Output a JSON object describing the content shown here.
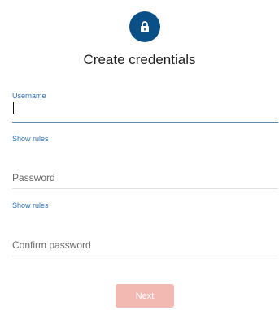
{
  "header": {
    "icon": "lock-icon",
    "title": "Create credentials"
  },
  "username": {
    "label": "Username",
    "value": "",
    "rules_link": "Show rules"
  },
  "password": {
    "placeholder": "Password",
    "rules_link": "Show rules"
  },
  "confirm_password": {
    "placeholder": "Confirm password"
  },
  "actions": {
    "next_label": "Next"
  },
  "colors": {
    "icon_circle": "#0a4f86",
    "link": "#2f6fb0",
    "next_button_disabled": "#f2b9b3"
  }
}
